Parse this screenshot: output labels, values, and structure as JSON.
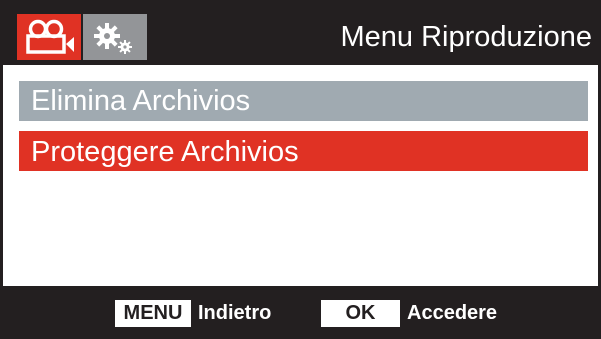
{
  "header": {
    "title": "Menu Riproduzione",
    "tabs": [
      {
        "icon": "video-camera-icon",
        "active": true
      },
      {
        "icon": "gears-icon",
        "active": false
      }
    ]
  },
  "menu": {
    "items": [
      {
        "label": "Elimina Archivios",
        "state": "normal"
      },
      {
        "label": "Proteggere Archivios",
        "state": "selected"
      }
    ]
  },
  "footer": {
    "menu_key": "MENU",
    "menu_action": "Indietro",
    "ok_key": "OK",
    "ok_action": "Accedere"
  },
  "colors": {
    "background": "#231f20",
    "accent": "#e03224",
    "inactive_tab": "#939598",
    "menu_item": "#a0aab1"
  }
}
